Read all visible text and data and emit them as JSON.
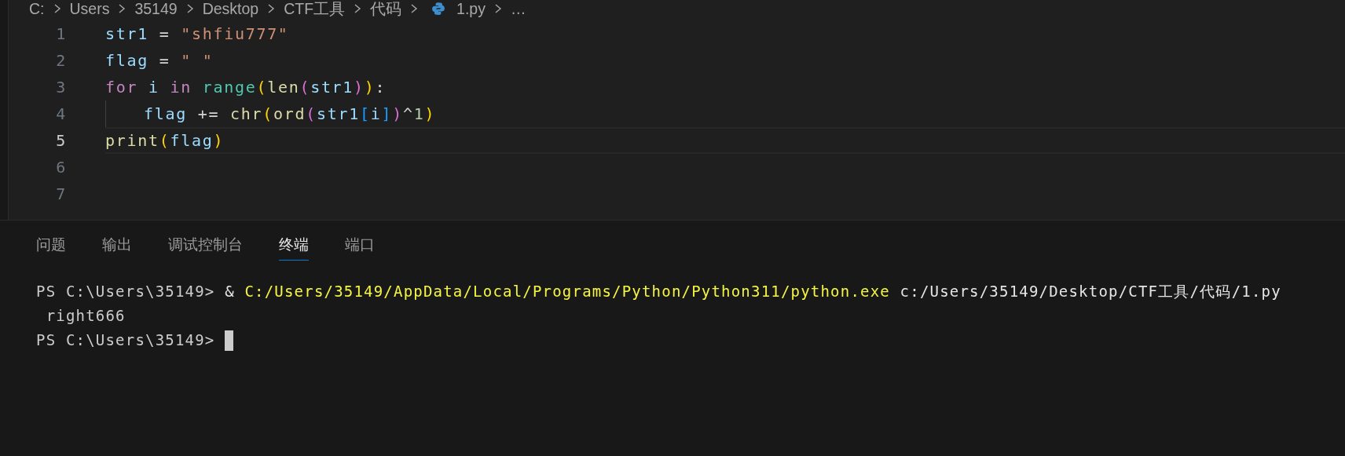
{
  "breadcrumb": [
    {
      "label": "C:",
      "kind": "folder"
    },
    {
      "label": "Users",
      "kind": "folder"
    },
    {
      "label": "35149",
      "kind": "folder"
    },
    {
      "label": "Desktop",
      "kind": "folder"
    },
    {
      "label": "CTF工具",
      "kind": "folder"
    },
    {
      "label": "代码",
      "kind": "folder"
    },
    {
      "label": "1.py",
      "kind": "python"
    },
    {
      "label": "…",
      "kind": "more"
    }
  ],
  "editor": {
    "lines": [
      {
        "number": "1",
        "current": false,
        "indent": false,
        "tokens": [
          {
            "t": "str1 ",
            "kind": "var"
          },
          {
            "t": "= ",
            "kind": "op"
          },
          {
            "t": "\"shfiu777\"",
            "kind": "str"
          }
        ]
      },
      {
        "number": "2",
        "current": false,
        "indent": false,
        "tokens": [
          {
            "t": "flag ",
            "kind": "var"
          },
          {
            "t": "= ",
            "kind": "op"
          },
          {
            "t": "\" \"",
            "kind": "str"
          }
        ]
      },
      {
        "number": "3",
        "current": false,
        "indent": false,
        "tokens": [
          {
            "t": "for ",
            "kind": "kw"
          },
          {
            "t": "i ",
            "kind": "var"
          },
          {
            "t": "in ",
            "kind": "kw"
          },
          {
            "t": "range",
            "kind": "cls"
          },
          {
            "t": "(",
            "kind": "b1"
          },
          {
            "t": "len",
            "kind": "fn"
          },
          {
            "t": "(",
            "kind": "b2"
          },
          {
            "t": "str1",
            "kind": "var"
          },
          {
            "t": ")",
            "kind": "b2"
          },
          {
            "t": ")",
            "kind": "b1"
          },
          {
            "t": ":",
            "kind": "op"
          }
        ]
      },
      {
        "number": "4",
        "current": false,
        "indent": true,
        "tokens": [
          {
            "t": "flag ",
            "kind": "var"
          },
          {
            "t": "+= ",
            "kind": "op"
          },
          {
            "t": "chr",
            "kind": "fn"
          },
          {
            "t": "(",
            "kind": "b1"
          },
          {
            "t": "ord",
            "kind": "fn"
          },
          {
            "t": "(",
            "kind": "b2"
          },
          {
            "t": "str1",
            "kind": "var"
          },
          {
            "t": "[",
            "kind": "b3"
          },
          {
            "t": "i",
            "kind": "var"
          },
          {
            "t": "]",
            "kind": "b3"
          },
          {
            "t": ")",
            "kind": "b2"
          },
          {
            "t": "^",
            "kind": "op"
          },
          {
            "t": "1",
            "kind": "num"
          },
          {
            "t": ")",
            "kind": "b1"
          }
        ]
      },
      {
        "number": "5",
        "current": true,
        "indent": false,
        "tokens": [
          {
            "t": "print",
            "kind": "fn"
          },
          {
            "t": "(",
            "kind": "b1"
          },
          {
            "t": "flag",
            "kind": "var"
          },
          {
            "t": ")",
            "kind": "b1"
          }
        ]
      },
      {
        "number": "6",
        "current": false,
        "indent": false
      },
      {
        "number": "7",
        "current": false,
        "indent": false
      }
    ]
  },
  "panel_tabs": [
    {
      "label": "问题",
      "selected": false
    },
    {
      "label": "输出",
      "selected": false
    },
    {
      "label": "调试控制台",
      "selected": false
    },
    {
      "label": "终端",
      "selected": true
    },
    {
      "label": "端口",
      "selected": false
    }
  ],
  "terminal": {
    "lines": [
      {
        "cursor": false,
        "segments": [
          {
            "t": "PS C:\\Users\\35149> ",
            "kind": "plain"
          },
          {
            "t": "& ",
            "kind": "bright"
          },
          {
            "t": "C:/Users/35149/AppData/Local/Programs/Python/Python311/python.exe",
            "kind": "command"
          },
          {
            "t": " c:/Users/35149/Desktop/CTF工具/代码/1.py",
            "kind": "bright"
          }
        ]
      },
      {
        "cursor": false,
        "segments": [
          {
            "t": " right666",
            "kind": "plain"
          }
        ]
      },
      {
        "cursor": true,
        "segments": [
          {
            "t": "PS C:\\Users\\35149> ",
            "kind": "plain"
          }
        ]
      }
    ]
  }
}
